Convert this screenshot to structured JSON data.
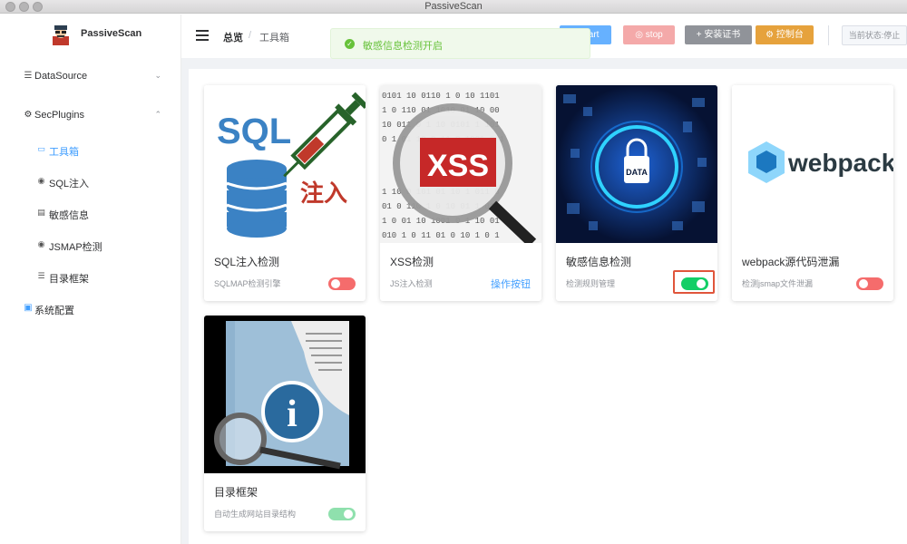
{
  "window": {
    "title": "PassiveScan"
  },
  "sidebar": {
    "logo_text": "PassiveScan",
    "menu": [
      {
        "label": "DataSource",
        "icon": "layers-icon"
      },
      {
        "label": "SecPlugins",
        "icon": "plugin-icon"
      },
      {
        "label": "系统配置",
        "icon": "settings-icon"
      }
    ],
    "submenu": [
      {
        "label": "工具箱",
        "icon": "monitor-icon"
      },
      {
        "label": "SQL注入",
        "icon": "bug-icon"
      },
      {
        "label": "敏感信息",
        "icon": "document-icon"
      },
      {
        "label": "JSMAP检测",
        "icon": "target-icon"
      },
      {
        "label": "目录框架",
        "icon": "list-icon"
      }
    ]
  },
  "header": {
    "breadcrumb": [
      "总览",
      "工具箱"
    ],
    "buttons": {
      "start": "start",
      "stop": "stop",
      "cert": "安装证书",
      "console": "控制台"
    },
    "status": "当前状态:停止"
  },
  "toast": {
    "message": "敏感信息检测开启"
  },
  "cards": [
    {
      "title": "SQL注入检测",
      "desc": "SQLMAP检测引擎",
      "switch_on": false,
      "image_text": [
        "SQL",
        "注入"
      ]
    },
    {
      "title": "XSS检测",
      "desc": "JS注入检测",
      "action": "操作按钮",
      "image_text": [
        "XSS"
      ]
    },
    {
      "title": "敏感信息检测",
      "desc": "检测规则管理",
      "switch_on": true,
      "image_text": [
        "DATA"
      ]
    },
    {
      "title": "webpack源代码泄漏",
      "desc": "检测jsmap文件泄漏",
      "switch_on": false,
      "image_text": [
        "webpack"
      ]
    },
    {
      "title": "目录框架",
      "desc": "自动生成网站目录结构",
      "switch_on": true,
      "image_text": [
        "i"
      ]
    }
  ],
  "colors": {
    "primary": "#409eff",
    "success": "#13ce66",
    "danger": "#f56c6c",
    "warning": "#e6a23c"
  }
}
